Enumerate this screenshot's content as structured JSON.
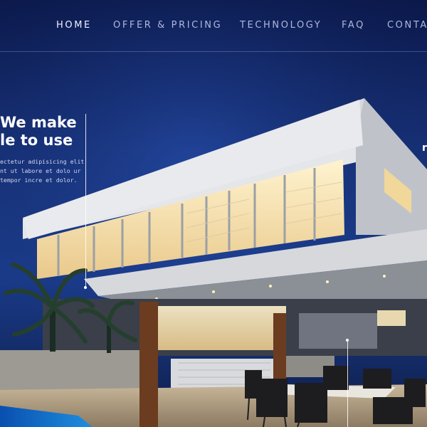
{
  "nav": {
    "items": [
      {
        "label": "HOME",
        "active": true
      },
      {
        "label": "OFFER & PRICING",
        "active": false
      },
      {
        "label": "TECHNOLOGY",
        "active": false
      },
      {
        "label": "FAQ",
        "active": false
      },
      {
        "label": "CONTA",
        "active": false
      }
    ]
  },
  "hero": {
    "title_line1": "We make",
    "title_line2": "le to use",
    "text_line1": "ectetur adipisicing elit",
    "text_line2": "nt ut labore et dolo ur",
    "text_line3": "tempor incre et dolor.",
    "right_fragment": "r"
  },
  "colors": {
    "sky_top": "#0d1a4d",
    "sky_mid": "#1e3a8f",
    "accent_text": "#ffffff",
    "nav_text": "#aeb8dc"
  },
  "image": {
    "subject": "house-photo"
  }
}
